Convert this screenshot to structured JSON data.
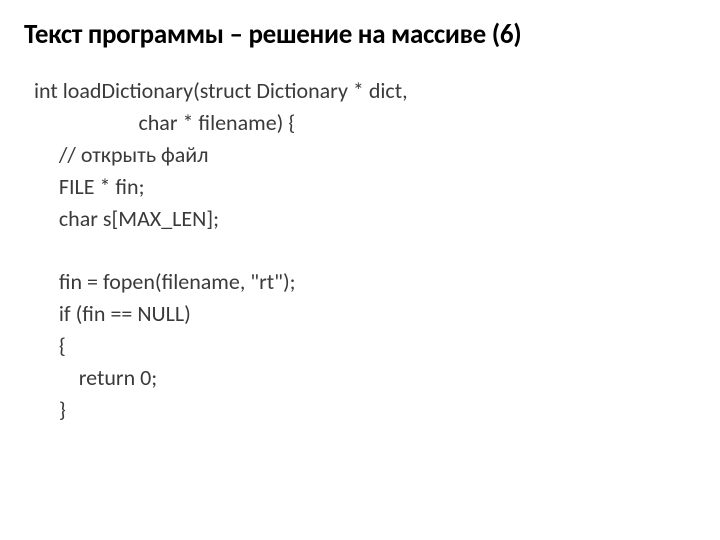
{
  "title": "Текст программы – решение на массиве (6)",
  "code": {
    "l1": "int loadDictionary(struct Dictionary * dict,",
    "l2": "                     char * filename) {",
    "l3": "     // открыть файл",
    "l4": "     FILE * fin;",
    "l5": "     char s[MAX_LEN];",
    "l6": " ",
    "l7": "     fin = fopen(filename, \"rt\");",
    "l8": "     if (fin == NULL)",
    "l9": "     {",
    "l10": "         return 0;",
    "l11": "     }"
  }
}
